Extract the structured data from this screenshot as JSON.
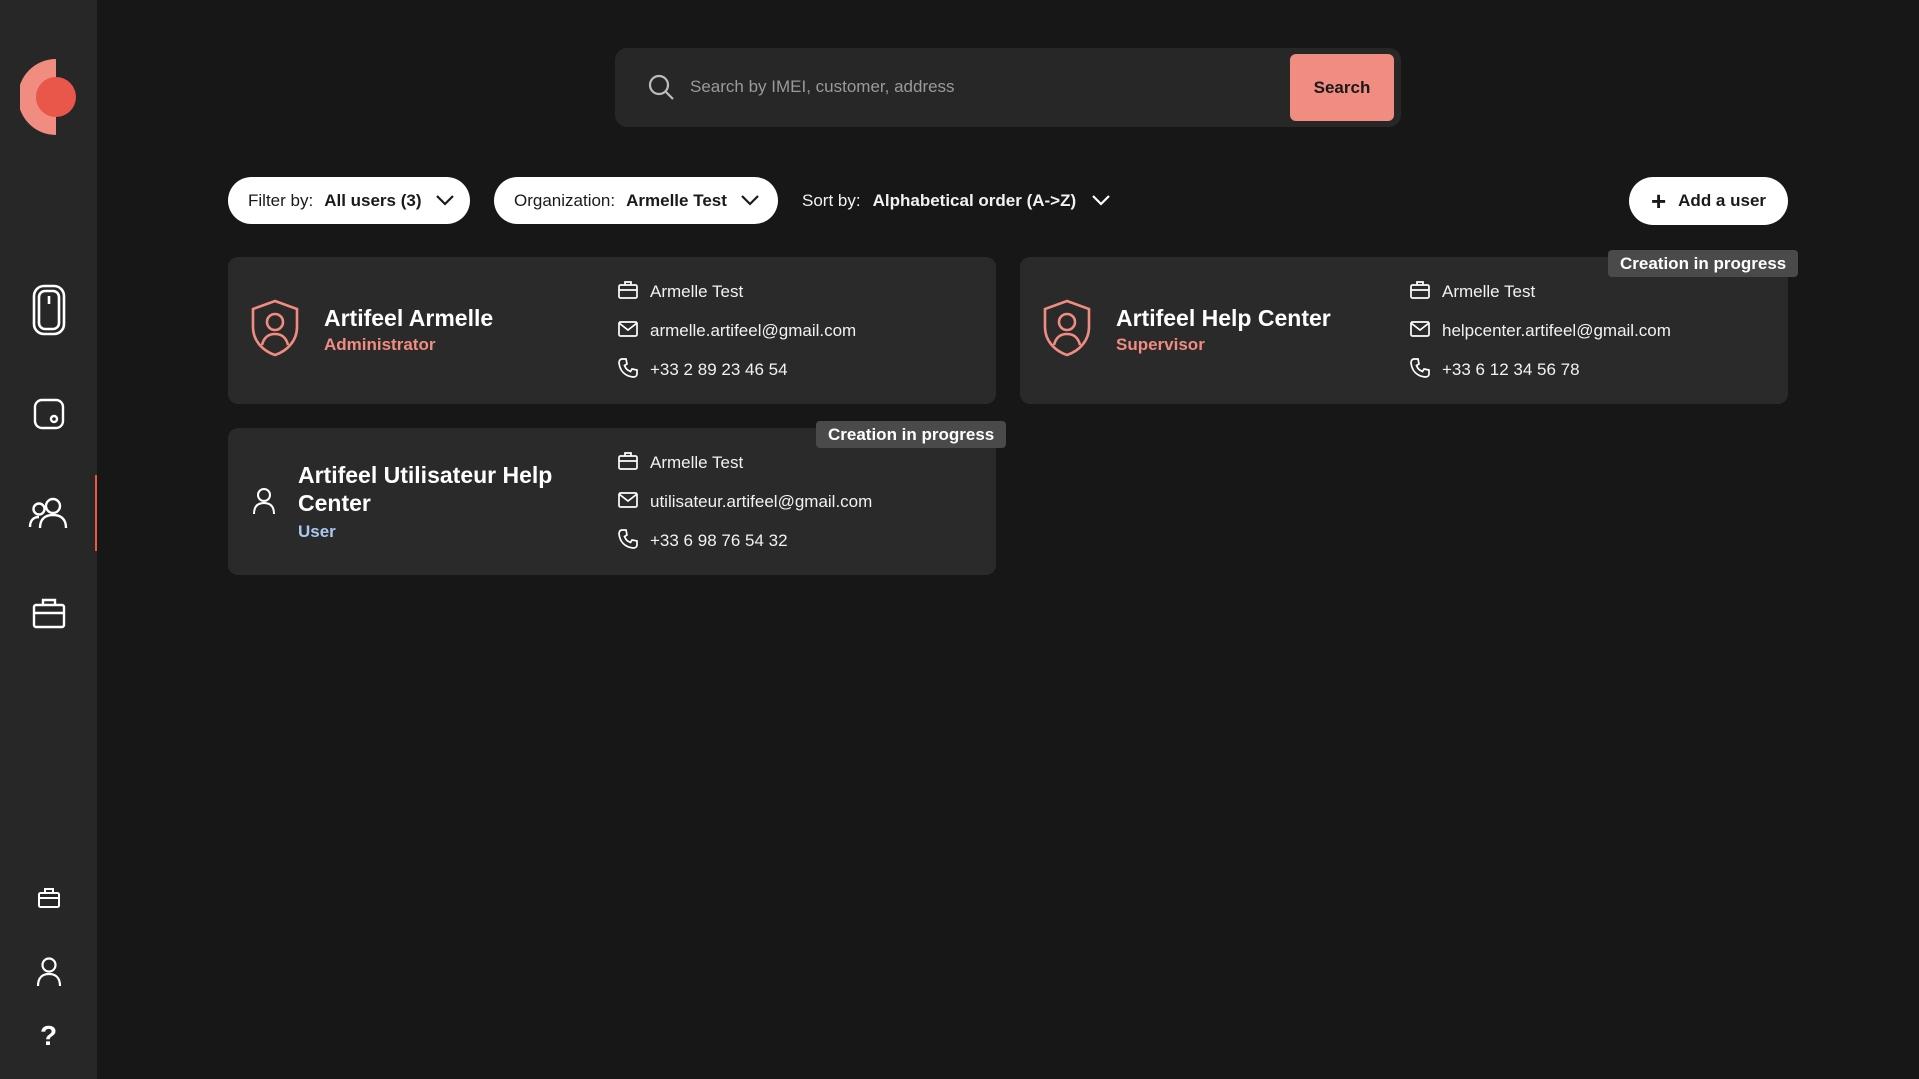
{
  "app": {
    "brand_color": "#e9574a",
    "accent_color": "#f08c80"
  },
  "sidebar": {
    "items": [
      {
        "icon": "phone-device-icon",
        "active": false
      },
      {
        "icon": "tablet-device-icon",
        "active": false
      },
      {
        "icon": "users-icon",
        "active": true
      },
      {
        "icon": "briefcase-icon",
        "active": false
      }
    ],
    "bottom_items": [
      {
        "icon": "briefcase-small-icon"
      },
      {
        "icon": "user-profile-icon"
      },
      {
        "icon": "help-icon",
        "label": "?"
      }
    ]
  },
  "search": {
    "placeholder": "Search by IMEI, customer, address",
    "value": "",
    "button_label": "Search"
  },
  "toolbar": {
    "filter_label": "Filter by:",
    "filter_value": "All users (3)",
    "organization_label": "Organization:",
    "organization_value": "Armelle Test",
    "sort_label": "Sort by:",
    "sort_value": "Alphabetical order (A->Z)",
    "add_user_label": "Add a user"
  },
  "users": [
    {
      "name": "Artifeel Armelle",
      "role": "Administrator",
      "role_color": "#f08c80",
      "organization": "Armelle Test",
      "email": "armelle.artifeel@gmail.com",
      "phone": "+33 2 89 23 46 54",
      "badge": ""
    },
    {
      "name": "Artifeel Help Center",
      "role": "Supervisor",
      "role_color": "#f08c80",
      "organization": "Armelle Test",
      "email": "helpcenter.artifeel@gmail.com",
      "phone": "+33 6 12 34 56 78",
      "badge": "Creation in progress"
    },
    {
      "name_line1": "Artifeel Utilisateur Help",
      "name_line2": "Center",
      "role": "User",
      "role_color": "#a9c8ef",
      "organization": "Armelle Test",
      "email": "utilisateur.artifeel@gmail.com",
      "phone": "+33 6 98 76 54 32",
      "badge": "Creation in progress"
    }
  ]
}
